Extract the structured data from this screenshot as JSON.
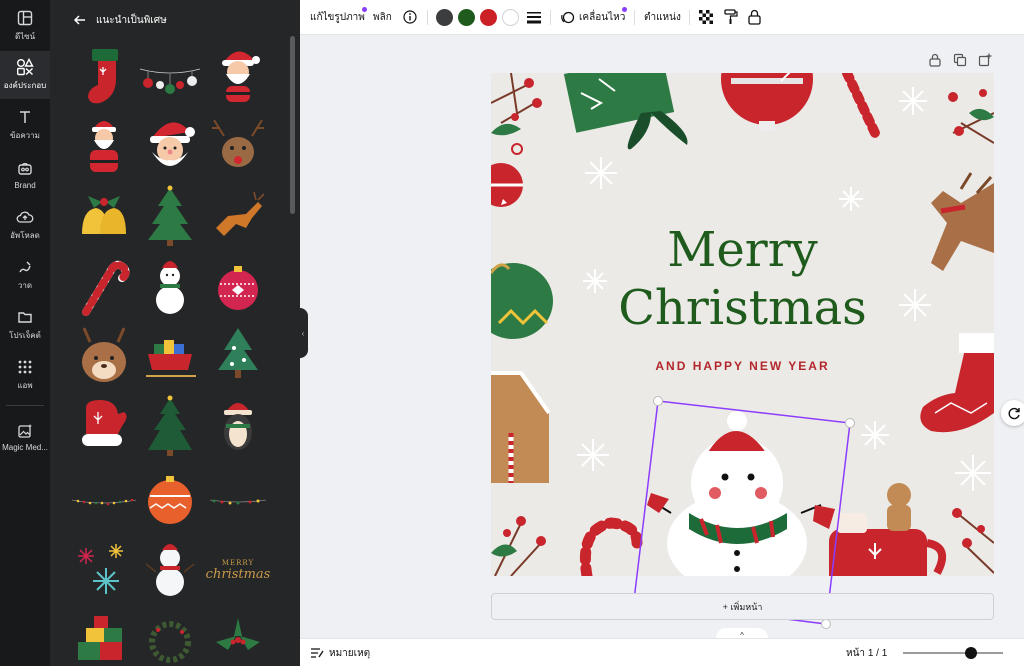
{
  "rail": {
    "items": [
      {
        "label": "ดีไซน์",
        "icon": "layout-icon"
      },
      {
        "label": "องค์ประกอบ",
        "icon": "elements-icon"
      },
      {
        "label": "ข้อความ",
        "icon": "text-icon"
      },
      {
        "label": "Brand",
        "icon": "brand-icon"
      },
      {
        "label": "อัพโหลด",
        "icon": "upload-icon"
      },
      {
        "label": "วาด",
        "icon": "draw-icon"
      },
      {
        "label": "โปรเจ็คต์",
        "icon": "folder-icon"
      },
      {
        "label": "แอพ",
        "icon": "apps-icon"
      },
      {
        "label": "Magic Med...",
        "icon": "magic-media-icon"
      }
    ]
  },
  "panel": {
    "title": "แนะนำเป็นพิเศษ",
    "items": [
      "stocking",
      "ornaments-string",
      "santa-face-waving",
      "santa-standing",
      "santa-head",
      "reindeer-face",
      "holly-bells",
      "christmas-tree",
      "jumping-reindeer",
      "candy-cane",
      "snowman",
      "red-bauble",
      "reindeer-head",
      "santa-sleigh",
      "green-tree",
      "red-mitten",
      "dark-tree",
      "penguin",
      "light-string",
      "orange-bauble",
      "light-string-small",
      "snowflakes",
      "snowman-small",
      "merry-christmas-lettering",
      "gifts-pile",
      "wreath",
      "holly-leaves"
    ],
    "thumb_text": {
      "line1": "MERRY",
      "line2": "christmas"
    }
  },
  "toolbar": {
    "edit_image": "แก้ไขรูปภาพ",
    "flip": "พลิก",
    "animate": "เคลื่อนไหว",
    "position": "ตำแหน่ง",
    "colors": [
      "#3c3d3f",
      "#1e5b1c",
      "#cc2027",
      "#ffffff"
    ],
    "accent": "#8b3dff"
  },
  "design": {
    "title_line1": "Merry",
    "title_line2": "Christmas",
    "subtitle": "AND HAPPY NEW YEAR",
    "title_color": "#1e5b1c",
    "subtitle_color": "#b3262b"
  },
  "add_page": "+ เพิ่มหน้า",
  "bottom": {
    "notes": "หมายเหตุ",
    "page_indicator": "หน้า 1 / 1",
    "zoom_fraction": 0.68
  }
}
